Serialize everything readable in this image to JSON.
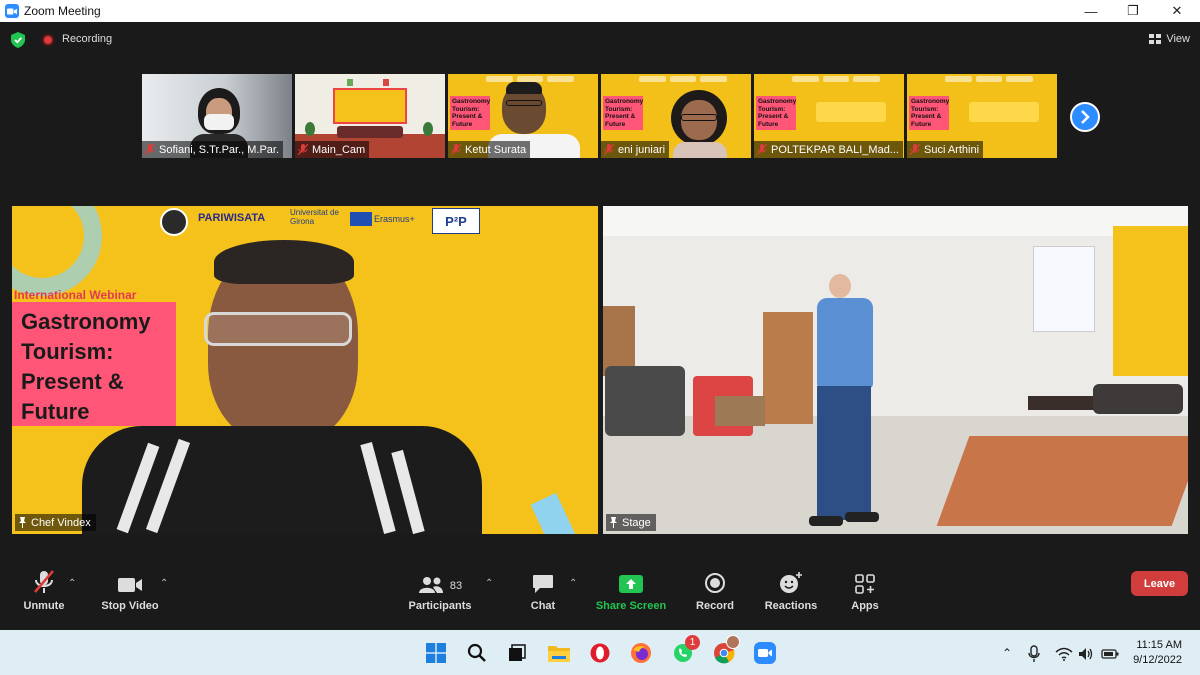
{
  "window": {
    "title": "Zoom Meeting",
    "minimize": "—",
    "restore": "❐",
    "close": "✕"
  },
  "status": {
    "recording_label": "Recording",
    "view_label": "View"
  },
  "participants_strip": [
    {
      "name": "Sofiani, S.Tr.Par., M.Par."
    },
    {
      "name": "Main_Cam"
    },
    {
      "name": "Ketut Surata"
    },
    {
      "name": "eni juniari"
    },
    {
      "name": "POLTEKPAR BALI_Mad..."
    },
    {
      "name": "Suci Arthini"
    }
  ],
  "thumb_poster_text": "Gastronomy Tourism: Present & Future",
  "main_tiles": [
    {
      "name": "Chef Vindex",
      "banner_small": "International Webinar",
      "banner_title": [
        "Gastronomy",
        "Tourism:",
        "Present &",
        "Future"
      ],
      "logo_text_1": "PARIWISATA",
      "logo_text_2": "Universitat de Girona",
      "logo_text_3": "Erasmus+",
      "logo_text_4": "P²P"
    },
    {
      "name": "Stage"
    }
  ],
  "toolbar": {
    "unmute": "Unmute",
    "stop_video": "Stop Video",
    "participants": "Participants",
    "participants_count": "83",
    "chat": "Chat",
    "share_screen": "Share Screen",
    "record": "Record",
    "reactions": "Reactions",
    "apps": "Apps",
    "leave": "Leave"
  },
  "taskbar": {
    "time": "11:15 AM",
    "date": "9/12/2022",
    "whatsapp_badge": "1"
  },
  "colors": {
    "zoom_blue": "#2d8cff",
    "share_green": "#23c552",
    "leave_red": "#d13c3c",
    "banner_yellow": "#f5c21b",
    "banner_pink": "#ff5577"
  }
}
